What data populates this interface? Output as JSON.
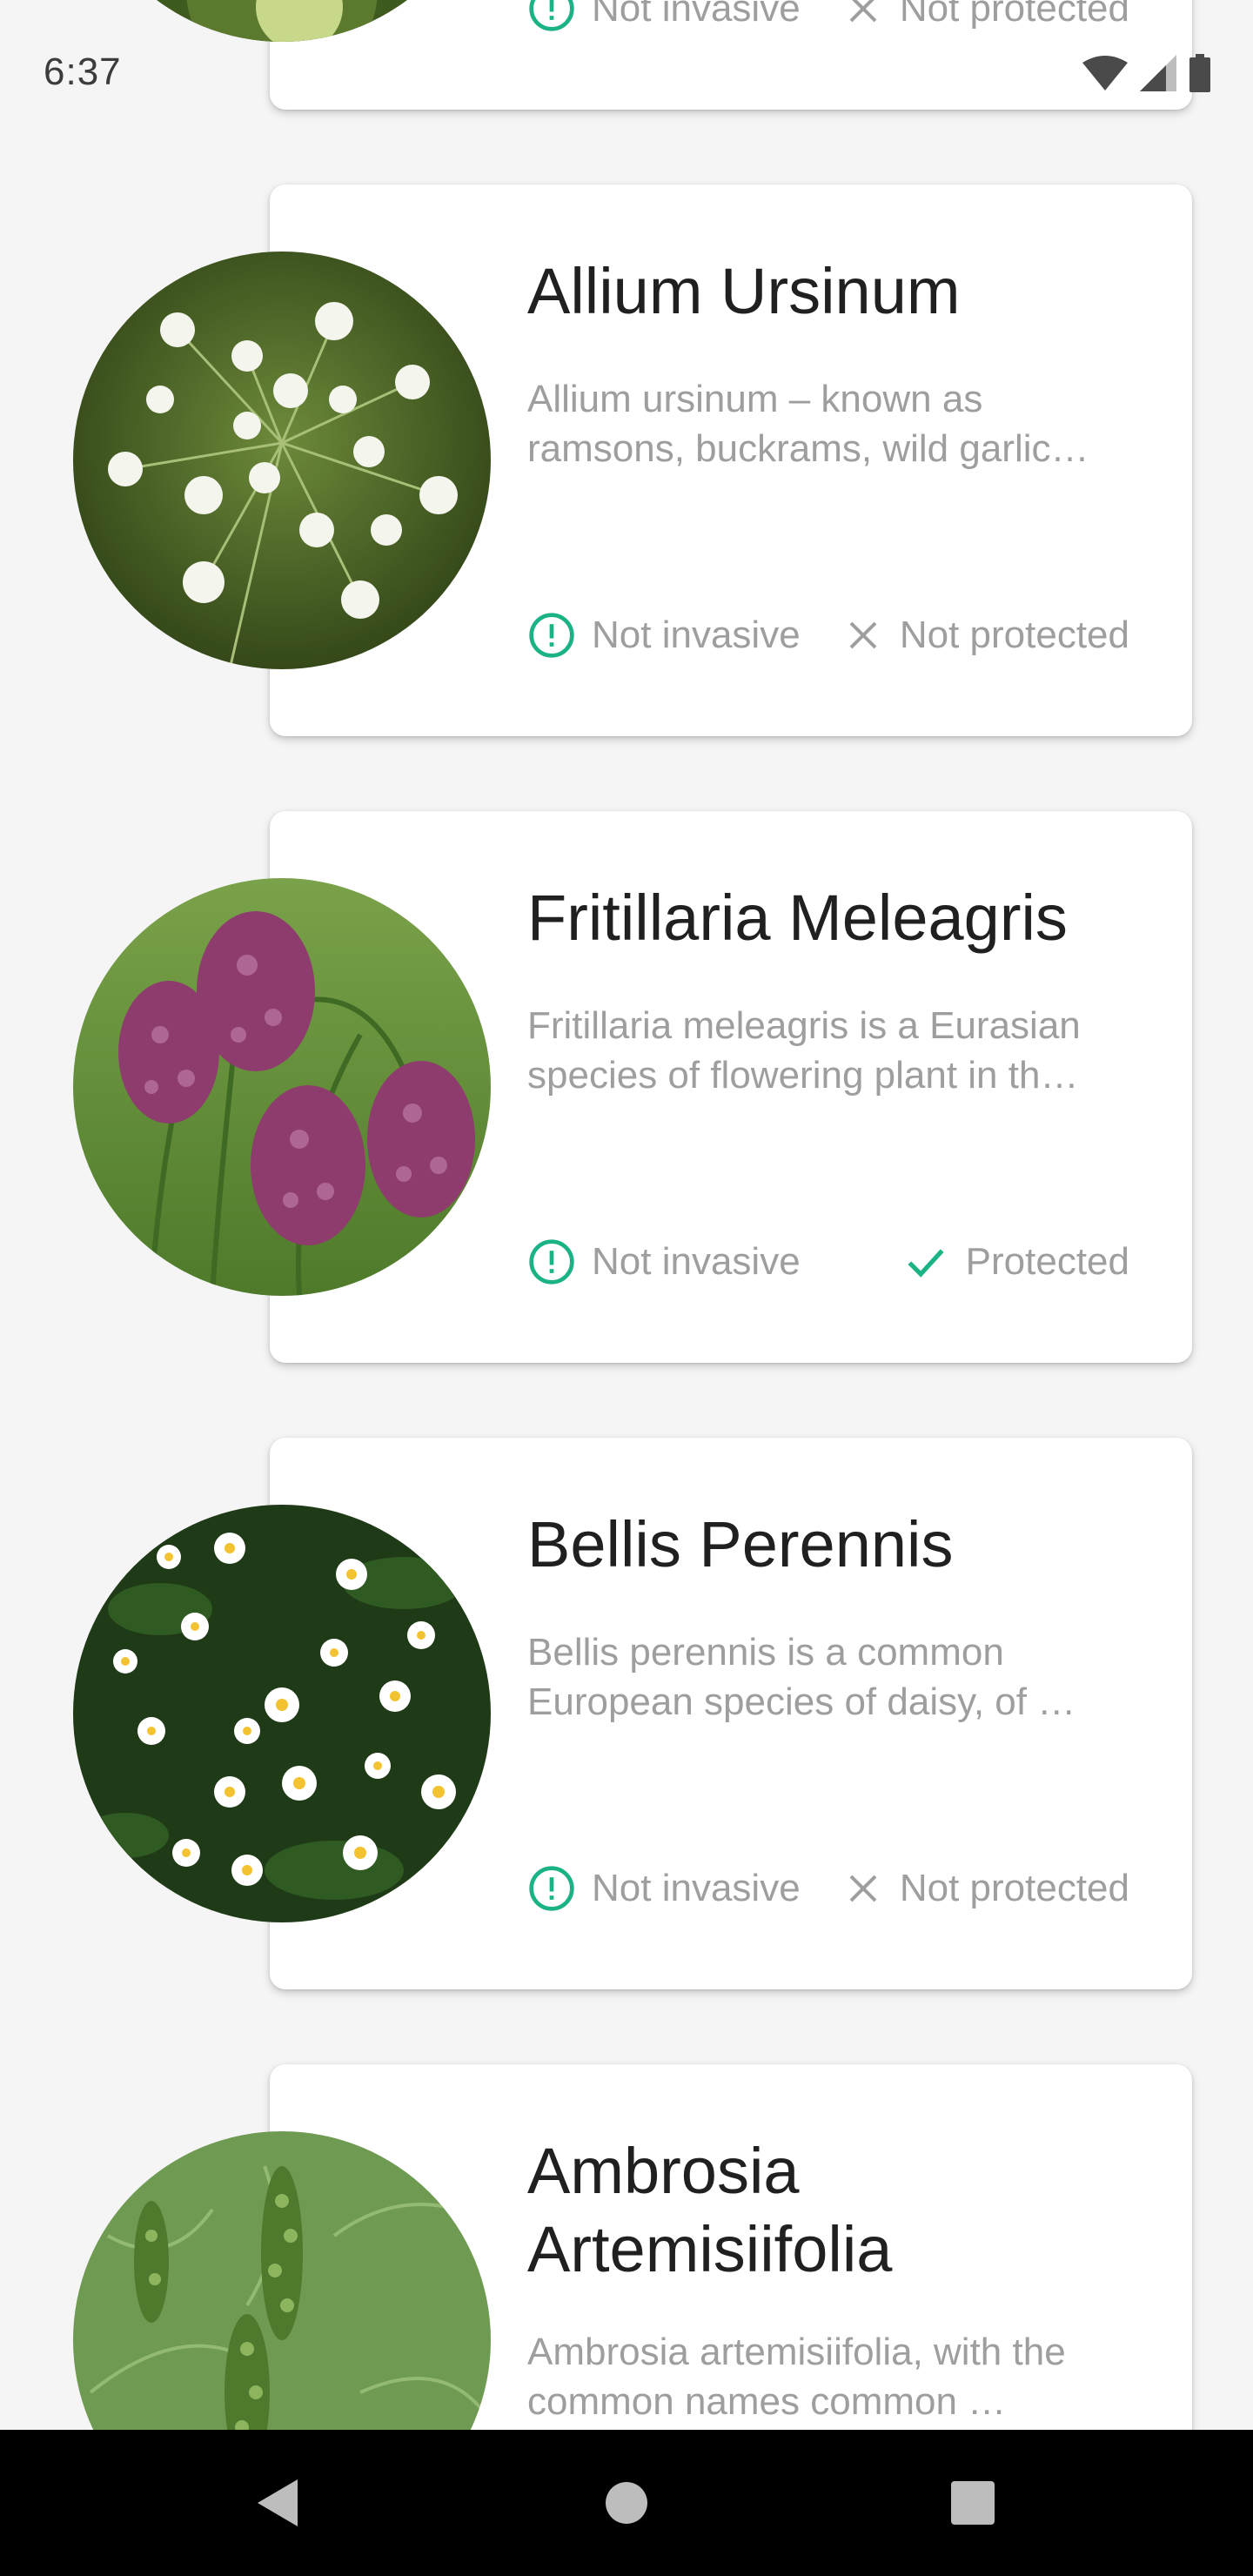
{
  "status_bar": {
    "time": "6:37",
    "icons": [
      "wifi-icon",
      "cellular-signal-icon",
      "battery-icon"
    ]
  },
  "colors": {
    "accent": "#1bb386",
    "title_text": "#202020",
    "secondary_text": "#9e9e9e",
    "background": "#f5f5f5",
    "card": "#ffffff",
    "nav_bar": "#000000"
  },
  "plants": [
    {
      "title": "",
      "description": [
        "",
        ""
      ],
      "invasive_label": "Not invasive",
      "protected_label": "Not protected",
      "protected": false
    },
    {
      "title": "Allium Ursinum",
      "description": [
        "Allium ursinum – known as",
        "ramsons, buckrams, wild garlic…"
      ],
      "invasive_label": "Not invasive",
      "protected_label": "Not protected",
      "protected": false
    },
    {
      "title": "Fritillaria Meleagris",
      "description": [
        "Fritillaria meleagris is a Eurasian",
        "species of flowering plant in th…"
      ],
      "invasive_label": "Not invasive",
      "protected_label": "Protected",
      "protected": true
    },
    {
      "title": "Bellis Perennis",
      "description": [
        "Bellis perennis is a common",
        "European species of daisy, of …"
      ],
      "invasive_label": "Not invasive",
      "protected_label": "Not protected",
      "protected": false
    },
    {
      "title_lines": [
        "Ambrosia",
        "Artemisiifolia"
      ],
      "description": [
        "Ambrosia artemisiifolia, with the",
        "common names common …"
      ]
    }
  ],
  "nav_bar": {
    "buttons": [
      "back-icon",
      "home-icon",
      "recents-icon"
    ]
  }
}
